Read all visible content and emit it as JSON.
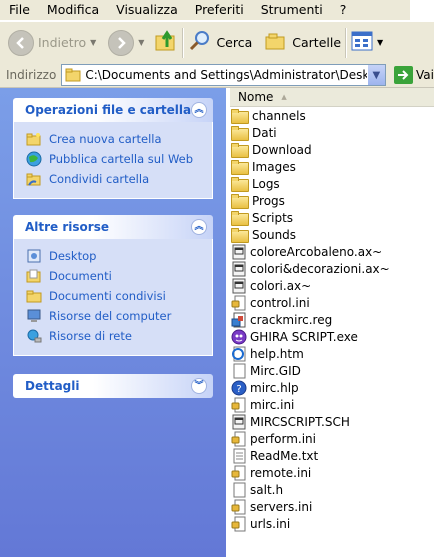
{
  "menu": [
    "File",
    "Modifica",
    "Visualizza",
    "Preferiti",
    "Strumenti",
    "?"
  ],
  "toolbar": {
    "back_label": "Indietro",
    "search_label": "Cerca",
    "folders_label": "Cartelle"
  },
  "address": {
    "label": "Indirizzo",
    "value": "C:\\Documents and Settings\\Administrator\\Desktop\\GHI",
    "go_label": "Vai"
  },
  "tasks": {
    "file_folder": {
      "title": "Operazioni file e cartella",
      "items": [
        "Crea nuova cartella",
        "Pubblica cartella sul Web",
        "Condividi cartella"
      ]
    },
    "other_places": {
      "title": "Altre risorse",
      "items": [
        "Desktop",
        "Documenti",
        "Documenti condivisi",
        "Risorse del computer",
        "Risorse di rete"
      ]
    },
    "details": {
      "title": "Dettagli"
    }
  },
  "list": {
    "column_name": "Nome",
    "files": [
      {
        "name": "channels",
        "icon": "folder"
      },
      {
        "name": "Dati",
        "icon": "folder"
      },
      {
        "name": "Download",
        "icon": "folder"
      },
      {
        "name": "Images",
        "icon": "folder"
      },
      {
        "name": "Logs",
        "icon": "folder"
      },
      {
        "name": "Progs",
        "icon": "folder"
      },
      {
        "name": "Scripts",
        "icon": "folder"
      },
      {
        "name": "Sounds",
        "icon": "folder"
      },
      {
        "name": "coloreArcobaleno.ax~",
        "icon": "system-file"
      },
      {
        "name": "colori&decorazioni.ax~",
        "icon": "system-file"
      },
      {
        "name": "colori.ax~",
        "icon": "system-file"
      },
      {
        "name": "control.ini",
        "icon": "settings-file"
      },
      {
        "name": "crackmirc.reg",
        "icon": "registry-file"
      },
      {
        "name": "GHIRA SCRIPT.exe",
        "icon": "executable"
      },
      {
        "name": "help.htm",
        "icon": "html-file"
      },
      {
        "name": "Mirc.GID",
        "icon": "document"
      },
      {
        "name": "mirc.hlp",
        "icon": "help-file"
      },
      {
        "name": "mirc.ini",
        "icon": "settings-file"
      },
      {
        "name": "MIRCSCRIPT.SCH",
        "icon": "system-file"
      },
      {
        "name": "perform.ini",
        "icon": "settings-file"
      },
      {
        "name": "ReadMe.txt",
        "icon": "text-file"
      },
      {
        "name": "remote.ini",
        "icon": "settings-file"
      },
      {
        "name": "salt.h",
        "icon": "document"
      },
      {
        "name": "servers.ini",
        "icon": "settings-file"
      },
      {
        "name": "urls.ini",
        "icon": "settings-file"
      }
    ]
  }
}
